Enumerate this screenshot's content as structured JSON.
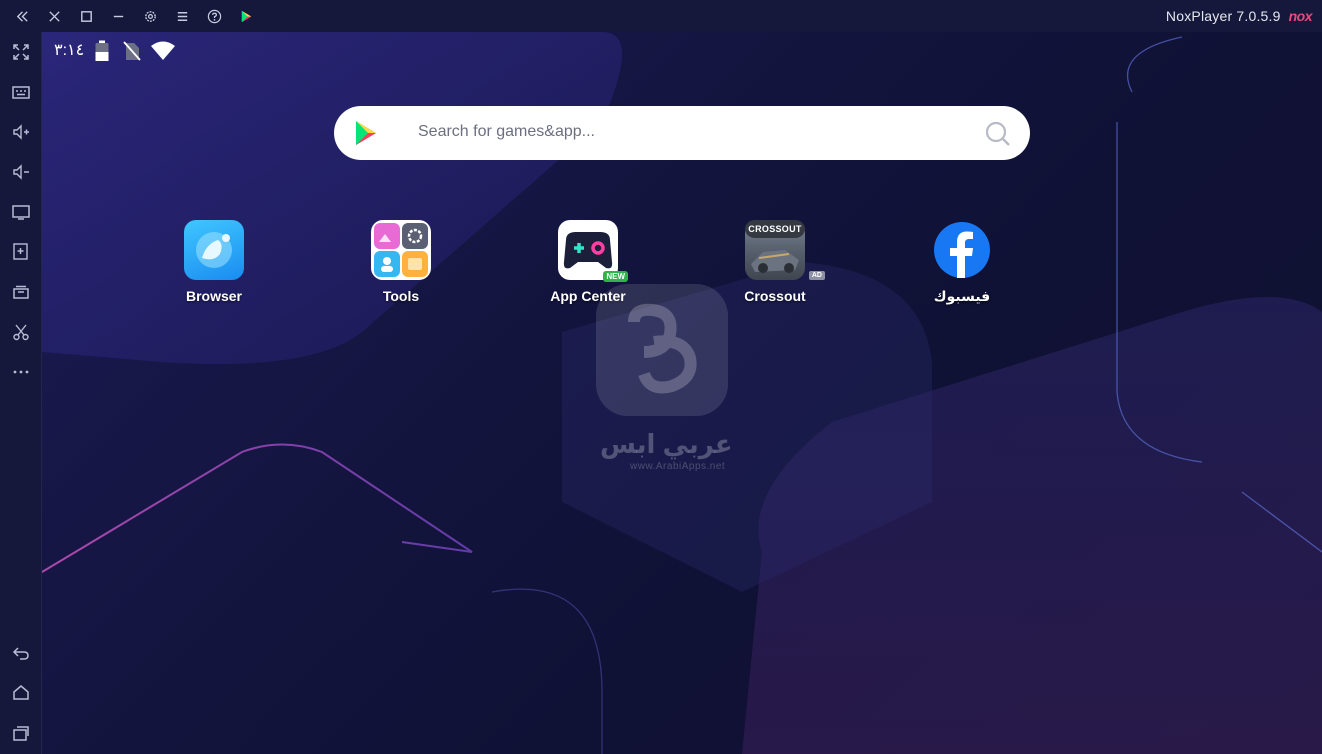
{
  "window": {
    "title": "NoxPlayer 7.0.5.9",
    "logo_text": "nox",
    "accent": "#e64b7a"
  },
  "titlebar_buttons": [
    "collapse-icon",
    "close-icon",
    "maximize-icon",
    "minimize-icon",
    "settings-icon",
    "menu-icon",
    "help-icon",
    "play-store-icon"
  ],
  "sidebar_buttons": [
    "fullscreen-icon",
    "keyboard-icon",
    "volume-up-icon",
    "volume-down-icon",
    "screen-icon",
    "apk-install-icon",
    "multi-instance-icon",
    "screenshot-icon",
    "more-icon",
    "back-icon",
    "home-icon",
    "recents-icon"
  ],
  "status_bar": {
    "time": "٣:١٤",
    "icons": [
      "battery-icon",
      "no-sim-icon",
      "wifi-icon"
    ]
  },
  "search": {
    "placeholder": "Search for games&app..."
  },
  "apps": [
    {
      "label": "Browser"
    },
    {
      "label": "Tools"
    },
    {
      "label": "App Center",
      "badge": "NEW"
    },
    {
      "label": "Crossout",
      "badge": "AD",
      "icon_text": "CROSSOUT"
    },
    {
      "label": "فيسبوك"
    }
  ],
  "watermark": {
    "text": "عربي ابس",
    "url": "www.ArabiApps.net"
  }
}
